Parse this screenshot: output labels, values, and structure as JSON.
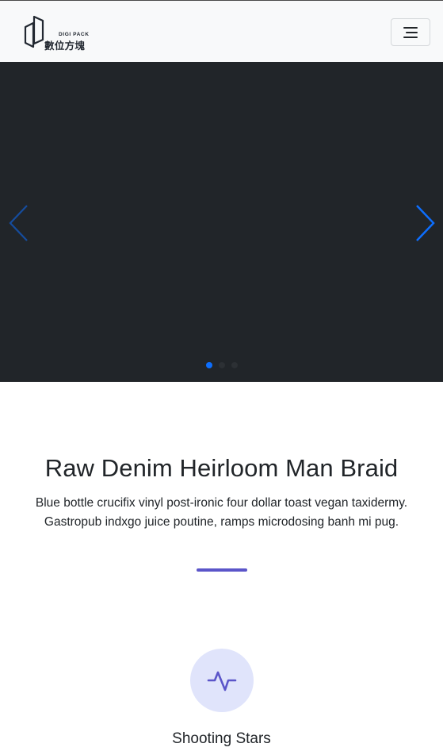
{
  "navbar": {
    "brand_sub": "DIGI PACK",
    "brand_name": "數位方塊",
    "menu_icon": "menu-icon"
  },
  "carousel": {
    "prev_icon": "chevron-left-icon",
    "next_icon": "chevron-right-icon",
    "slide_count": 3,
    "active_index": 0,
    "background_color": "#212529",
    "accent_color": "#0d6efd"
  },
  "feature": {
    "title": "Raw Denim Heirloom Man Braid",
    "text": "Blue bottle crucifix vinyl post-ironic four dollar toast vegan taxidermy. Gastropub indxgo juice poutine, ramps microdosing banh mi pug.",
    "divider_color": "#5b55c9"
  },
  "card": {
    "icon": "activity-icon",
    "icon_color": "#5b55c9",
    "icon_bg": "#e0e4fb",
    "title": "Shooting Stars"
  }
}
